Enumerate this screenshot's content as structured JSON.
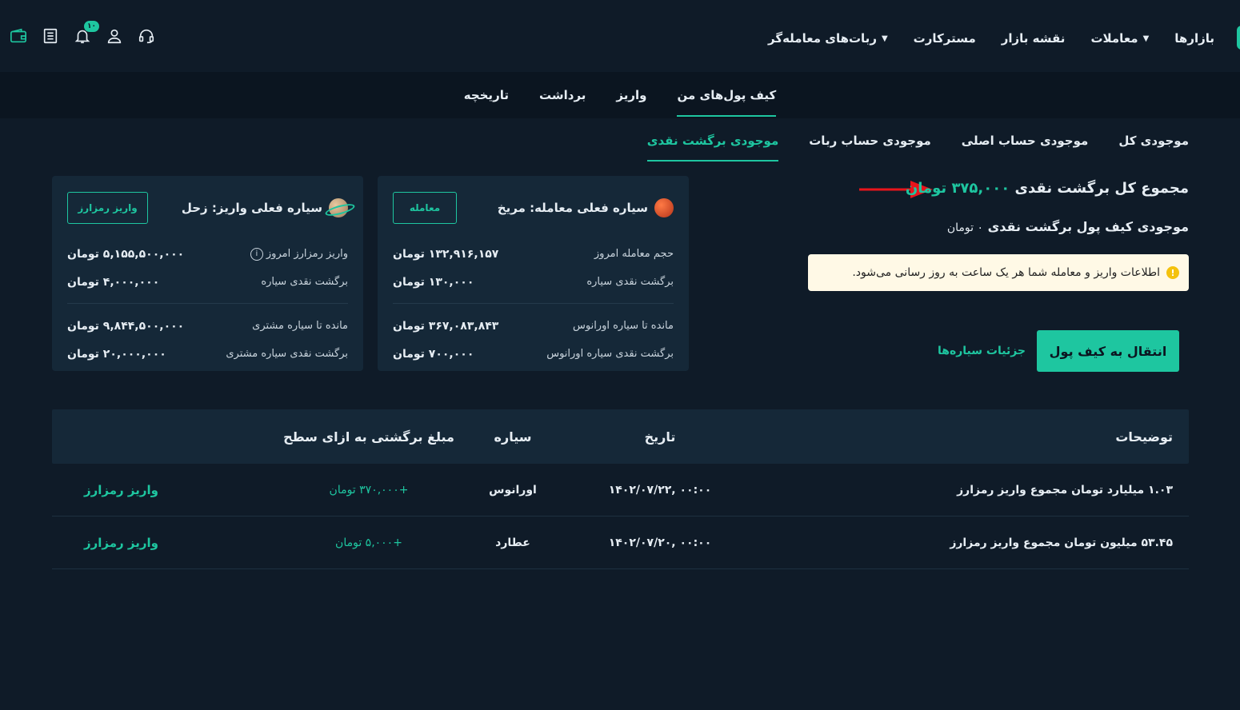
{
  "topnav": {
    "menu": [
      {
        "label": "بازارها",
        "caret": false
      },
      {
        "label": "معاملات",
        "caret": true
      },
      {
        "label": "نقشه بازار",
        "caret": false
      },
      {
        "label": "مسترکارت",
        "caret": false
      },
      {
        "label": "ربات‌های معامله‌گر",
        "caret": true
      }
    ],
    "notification_count": "۱۰"
  },
  "wallet_tabs": [
    "کیف پول‌های من",
    "واریز",
    "برداشت",
    "تاریخچه"
  ],
  "sub_tabs": [
    "موجودی کل",
    "موجودی حساب اصلی",
    "موجودی حساب ربات",
    "موجودی برگشت نقدی"
  ],
  "summary": {
    "total_label": "مجموع کل برگشت نقدی",
    "total_value": "۳۷۵,۰۰۰ تومان",
    "wallet_label": "موجودی کیف پول برگشت نقدی",
    "wallet_value": "۰ تومان",
    "notice": "اطلاعات واریز و معامله شما هر یک ساعت به روز رسانی می‌شود.",
    "transfer_button": "انتقال به کیف پول",
    "planet_details_link": "جزئیات سیاره‌ها"
  },
  "cards": {
    "mars": {
      "title": "سیاره فعلی معامله: مریخ",
      "button": "معامله",
      "rows": [
        {
          "label": "حجم معامله امروز",
          "value": "۱۳۲,۹۱۶,۱۵۷ تومان"
        },
        {
          "label": "برگشت نقدی سیاره",
          "value": "۱۳۰,۰۰۰  تومان"
        },
        {
          "label": "مانده تا سیاره اورانوس",
          "value": "۳۶۷,۰۸۳,۸۴۳ تومان"
        },
        {
          "label": "برگشت نقدی سیاره اورانوس",
          "value": "۷۰۰,۰۰۰  تومان"
        }
      ]
    },
    "saturn": {
      "title": "سیاره فعلی واریز: زحل",
      "button": "واریز رمزارز",
      "rows": [
        {
          "label": "واریز رمزارز امروز",
          "value": "۵,۱۵۵,۵۰۰,۰۰۰ تومان"
        },
        {
          "label": "برگشت نقدی سیاره",
          "value": "۴,۰۰۰,۰۰۰  تومان"
        },
        {
          "label": "مانده تا سیاره مشتری",
          "value": "۹,۸۴۴,۵۰۰,۰۰۰ تومان"
        },
        {
          "label": "برگشت نقدی سیاره مشتری",
          "value": "۲۰,۰۰۰,۰۰۰  تومان"
        }
      ]
    }
  },
  "table": {
    "headers": [
      "توضیحات",
      "تاریخ",
      "سیاره",
      "مبلغ برگشتی به ازای سطح"
    ],
    "rows": [
      {
        "desc": "۱.۰۳ میلیارد تومان مجموع واریز رمزارز",
        "date": "۱۴۰۲/۰۷/۲۲, ۰۰:۰۰",
        "planet": "اورانوس",
        "amount": "+۳۷۰,۰۰۰ تومان",
        "action": "واریز رمزارز"
      },
      {
        "desc": "۵۳.۴۵ میلیون تومان مجموع واریز رمزارز",
        "date": "۱۴۰۲/۰۷/۲۰, ۰۰:۰۰",
        "planet": "عطارد",
        "amount": "+۵,۰۰۰ تومان",
        "action": "واریز رمزارز"
      }
    ]
  },
  "colors": {
    "accent": "#1ec6a0",
    "background": "#0f1b28",
    "card": "#152838",
    "arrow": "#e8141b"
  }
}
